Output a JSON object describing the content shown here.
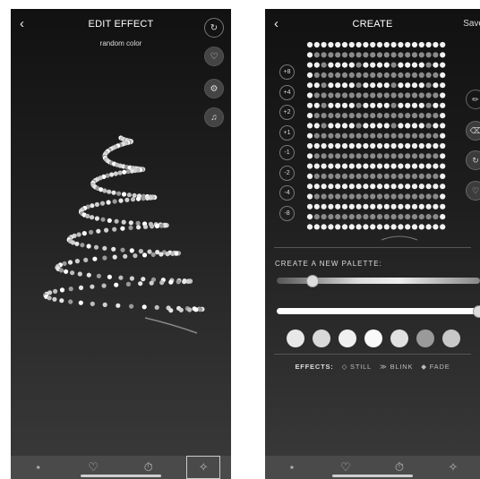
{
  "left": {
    "back_icon": "chevron-left-icon",
    "title": "EDIT EFFECT",
    "subtitle": "random color",
    "side_buttons": [
      "refresh-icon",
      "heart-icon",
      "settings-icon",
      "music-icon"
    ],
    "tabs": [
      {
        "icon": "tree-icon",
        "glyph": "🎄"
      },
      {
        "icon": "heart-icon",
        "glyph": "♡"
      },
      {
        "icon": "timer-icon",
        "glyph": "⏱"
      },
      {
        "icon": "magic-wand-icon",
        "glyph": "✧"
      }
    ]
  },
  "right": {
    "back_icon": "chevron-left-icon",
    "title": "CREATE",
    "save_label": "Save",
    "offsets": [
      "+8",
      "+4",
      "+2",
      "+1",
      "-1",
      "-2",
      "-4",
      "-8"
    ],
    "side_tools": [
      "brush-icon",
      "eraser-icon",
      "refresh-icon",
      "heart-icon"
    ],
    "palette_label": "CREATE A NEW PALETTE:",
    "swatch_colors": [
      "#e8e8e8",
      "#d9d9d9",
      "#f0f0f0",
      "#fafafa",
      "#e0e0e0",
      "#9a9a9a",
      "#c8c8c8"
    ],
    "effects_label": "EFFECTS:",
    "effects": [
      "STILL",
      "BLINK",
      "FADE"
    ],
    "tabs": [
      {
        "icon": "tree-icon",
        "glyph": "🎄"
      },
      {
        "icon": "heart-icon",
        "glyph": "♡"
      },
      {
        "icon": "timer-icon",
        "glyph": "⏱"
      },
      {
        "icon": "magic-wand-icon",
        "glyph": "✧"
      }
    ]
  }
}
